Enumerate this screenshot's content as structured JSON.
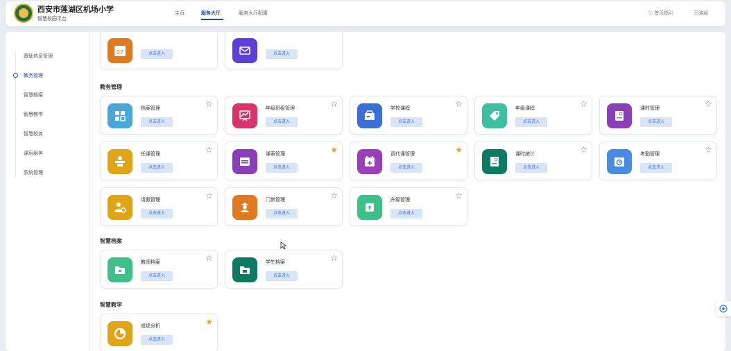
{
  "header": {
    "school_name": "西安市莲湖区机场小学",
    "platform_name": "智慧校园平台",
    "nav": [
      {
        "label": "主页"
      },
      {
        "label": "服务大厅"
      },
      {
        "label": "服务大厅配置"
      }
    ],
    "help_label": "首页指引",
    "user_label": "王晓斌"
  },
  "sidebar": {
    "items": [
      {
        "label": "基础信息管理"
      },
      {
        "label": "教务管理"
      },
      {
        "label": "智慧档案"
      },
      {
        "label": "智慧教学"
      },
      {
        "label": "智慧校务"
      },
      {
        "label": "课后服务"
      },
      {
        "label": "系统管理"
      }
    ]
  },
  "enter_label": "点击进入",
  "sections": [
    {
      "title": "教务管理"
    },
    {
      "title": "智慧档案"
    },
    {
      "title": "智慧教学"
    }
  ],
  "cards": [
    {
      "title": "档案管理",
      "starred": false,
      "color": "#4aa8d8",
      "icon": "grid-icon"
    },
    {
      "title": "年级班级管理",
      "starred": false,
      "color": "#d8336b",
      "icon": "chart-board-icon"
    },
    {
      "title": "学校课程",
      "starred": false,
      "color": "#3b6fd8",
      "icon": "cart-icon"
    },
    {
      "title": "年级课程",
      "starred": false,
      "color": "#3fbf9f",
      "icon": "tag-icon"
    },
    {
      "title": "课时管理",
      "starred": false,
      "color": "#8a3fb8",
      "icon": "book-icon"
    },
    {
      "title": "任课管理",
      "starred": false,
      "color": "#e0a417",
      "icon": "teacher-icon"
    },
    {
      "title": "课表管理",
      "starred": true,
      "color": "#8a3fb8",
      "icon": "schedule-icon"
    },
    {
      "title": "调代课管理",
      "starred": true,
      "color": "#9b3fb8",
      "icon": "calendar-plus-icon"
    },
    {
      "title": "课时统计",
      "starred": false,
      "color": "#0f7a62",
      "icon": "book-icon"
    },
    {
      "title": "考勤管理",
      "starred": false,
      "color": "#4a8ae0",
      "icon": "clock-calendar-icon"
    },
    {
      "title": "请假管理",
      "starred": false,
      "color": "#e0a417",
      "icon": "person-leave-icon"
    },
    {
      "title": "门禁管理",
      "starred": false,
      "color": "#e07a20",
      "icon": "guard-icon"
    },
    {
      "title": "升级管理",
      "starred": false,
      "color": "#3fbf8a",
      "icon": "upgrade-icon"
    },
    {
      "title": "教师档案",
      "starred": false,
      "color": "#3fbf8a",
      "icon": "folder-icon"
    },
    {
      "title": "学生档案",
      "starred": false,
      "color": "#0f7a62",
      "icon": "student-folder-icon"
    },
    {
      "title": "成绩分析",
      "starred": true,
      "color": "#e0a417",
      "icon": "pie-icon"
    }
  ],
  "partial_cards": [
    {
      "color": "#e07a20",
      "icon": "calendar-icon",
      "icon_text": "07"
    },
    {
      "color": "#5b3fd8",
      "icon": "mail-icon"
    }
  ]
}
